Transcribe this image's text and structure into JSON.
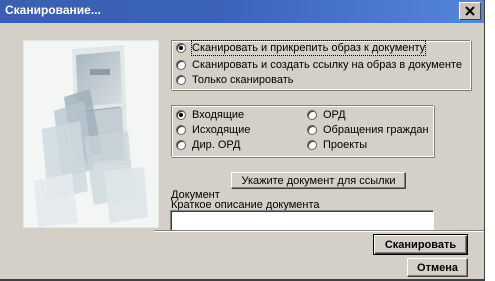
{
  "window": {
    "title": "Сканирование..."
  },
  "icons": {
    "close": "close-icon",
    "illustration": "scanner-illustration"
  },
  "scan_mode": {
    "options": [
      {
        "label": "Сканировать и прикрепить образ к документу",
        "checked": true
      },
      {
        "label": "Сканировать и создать ссылку на образ в документе",
        "checked": false
      },
      {
        "label": "Только сканировать",
        "checked": false
      }
    ]
  },
  "doc_type": {
    "options": [
      {
        "label": "Входящие",
        "checked": true
      },
      {
        "label": "Исходящие",
        "checked": false
      },
      {
        "label": "Дир. ОРД",
        "checked": false
      },
      {
        "label": "ОРД",
        "checked": false
      },
      {
        "label": "Обращения граждан",
        "checked": false
      },
      {
        "label": "Проекты",
        "checked": false
      }
    ]
  },
  "reference": {
    "button_label": "Укажите документ для ссылки",
    "document_label": "Документ",
    "description_label": "Краткое описание документа",
    "description_value": ""
  },
  "actions": {
    "scan_label": "Сканировать",
    "cancel_label": "Отмена"
  },
  "colors": {
    "titlebar": "#3a63b8",
    "dialog": "#d4d0c8"
  }
}
